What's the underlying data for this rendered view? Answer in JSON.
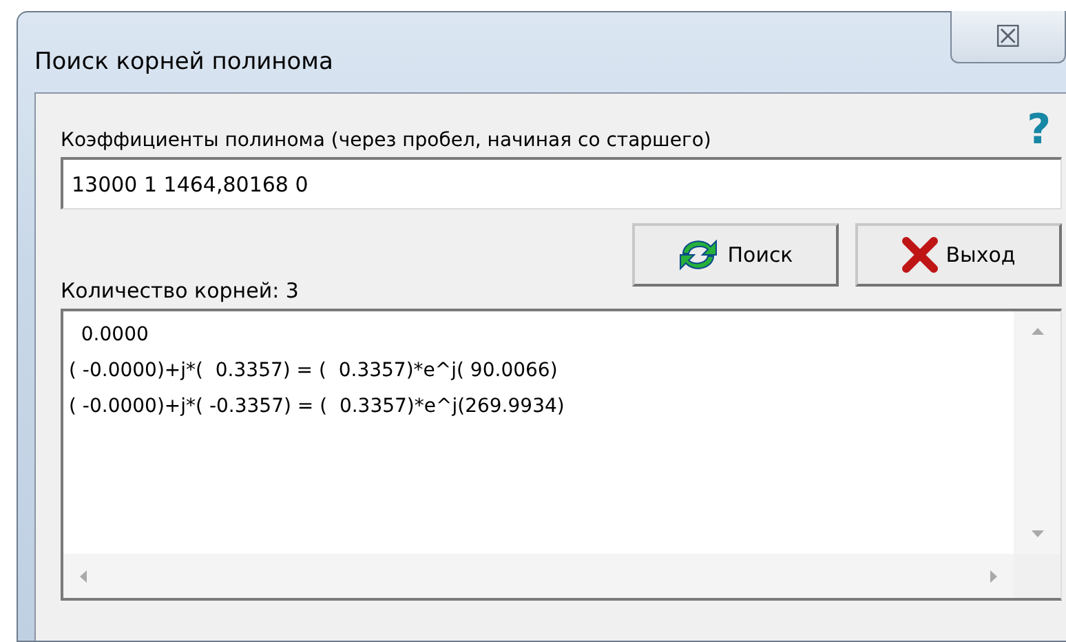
{
  "window": {
    "title": "Поиск корней полинома",
    "close": "☒"
  },
  "coefficients": {
    "label": "Коэффициенты полинома (через пробел, начиная со старшего)",
    "value": "13000 1 1464,80168 0",
    "help": "?"
  },
  "buttons": [
    {
      "kind": "search",
      "label": "Поиск"
    },
    {
      "kind": "exit",
      "label": "Выход"
    }
  ],
  "root_count": "Количество корней: 3",
  "results": [
    "  0.0000",
    "( -0.0000)+j*(  0.3357) = (  0.3357)*e^j( 90.0066)",
    "( -0.0000)+j*( -0.3357) = (  0.3357)*e^j(269.9934)"
  ]
}
